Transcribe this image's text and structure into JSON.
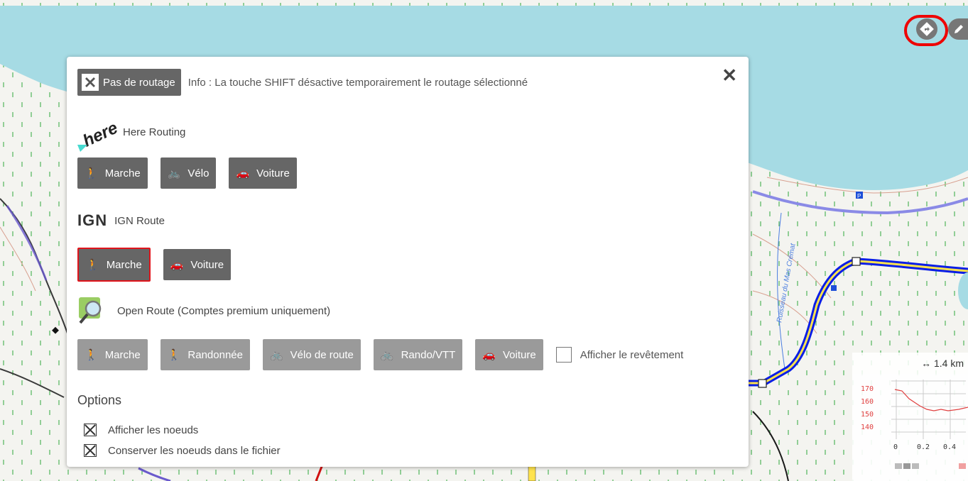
{
  "toolbar": {
    "routing_icon": "routing-diamond-icon",
    "edit_icon": "pencil-icon"
  },
  "panel": {
    "no_routing_label": "Pas de routage",
    "info_text": "Info : La touche SHIFT désactive temporairement le routage sélectionné",
    "close_symbol": "✕",
    "providers": {
      "here": {
        "logo_text": "here",
        "name": "Here Routing",
        "modes": [
          "Marche",
          "Vélo",
          "Voiture"
        ]
      },
      "ign": {
        "logo_text": "IGN",
        "name": "IGN Route",
        "modes": [
          "Marche",
          "Voiture"
        ],
        "selected": "Marche"
      },
      "openroute": {
        "name": "Open Route (Comptes premium uniquement)",
        "modes": [
          "Marche",
          "Randonnée",
          "Vélo de route",
          "Rando/VTT",
          "Voiture"
        ],
        "surface_label": "Afficher le revêtement"
      }
    },
    "options": {
      "title": "Options",
      "show_nodes": "Afficher les noeuds",
      "keep_nodes": "Conserver les noeuds dans le fichier"
    }
  },
  "map": {
    "stream_label": "Ruisseau du Mas Crémat"
  },
  "scale": {
    "label": "↔ 1.4 km"
  },
  "elevation": {
    "y_ticks": [
      "170",
      "160",
      "150",
      "140"
    ],
    "x_ticks": [
      "0",
      "0.2",
      "0.4"
    ]
  },
  "colors": {
    "sea": "#a6dbe4",
    "route_blue": "#0a1ee6",
    "route_yellow": "#ffe34d",
    "button_dark": "#666666",
    "button_light": "#9a9a9a",
    "selected_border": "#e0141b",
    "highlight_ring": "#e00000"
  }
}
